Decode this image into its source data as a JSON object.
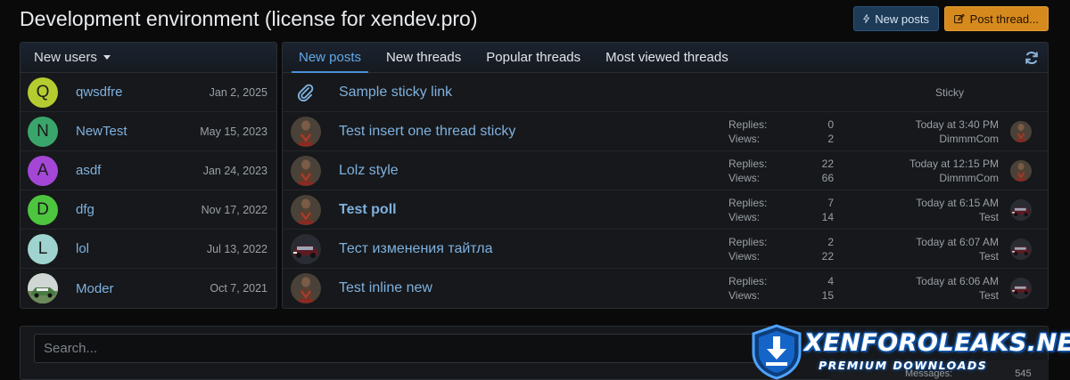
{
  "page": {
    "title": "Development environment (license for xendev.pro)"
  },
  "actions": {
    "new_posts": "New posts",
    "post_thread": "Post thread..."
  },
  "new_users": {
    "header": "New users",
    "items": [
      {
        "letter": "Q",
        "name": "qwsdfre",
        "date": "Jan 2, 2025",
        "color": "#b4cc2f"
      },
      {
        "letter": "N",
        "name": "NewTest",
        "date": "May 15, 2023",
        "color": "#3aa56b"
      },
      {
        "letter": "A",
        "name": "asdf",
        "date": "Jan 24, 2023",
        "color": "#a447d6"
      },
      {
        "letter": "D",
        "name": "dfg",
        "date": "Nov 17, 2022",
        "color": "#4ec53f"
      },
      {
        "letter": "L",
        "name": "lol",
        "date": "Jul 13, 2022",
        "color": "#9fd3cf"
      },
      {
        "letter": "",
        "name": "Moder",
        "date": "Oct 7, 2021",
        "color": "#6d8a6a"
      }
    ]
  },
  "tabs": [
    "New posts",
    "New threads",
    "Popular threads",
    "Most viewed threads"
  ],
  "threads": {
    "sticky_link": {
      "title": "Sample sticky link",
      "badge": "Sticky"
    },
    "replies_label": "Replies:",
    "views_label": "Views:",
    "items": [
      {
        "title": "Test insert one thread sticky",
        "replies": "0",
        "views": "2",
        "time": "Today at 3:40 PM",
        "user": "DimmmCom",
        "bold": false,
        "avatar": "statue"
      },
      {
        "title": "Lolz style",
        "replies": "22",
        "views": "66",
        "time": "Today at 12:15 PM",
        "user": "DimmmCom",
        "bold": false,
        "avatar": "statue"
      },
      {
        "title": "Test poll",
        "replies": "7",
        "views": "14",
        "time": "Today at 6:15 AM",
        "user": "Test",
        "bold": true,
        "avatar": "statue"
      },
      {
        "title": "Тест изменения тайтла",
        "replies": "2",
        "views": "22",
        "time": "Today at 6:07 AM",
        "user": "Test",
        "bold": false,
        "avatar": "car"
      },
      {
        "title": "Test inline new",
        "replies": "4",
        "views": "15",
        "time": "Today at 6:06 AM",
        "user": "Test",
        "bold": false,
        "avatar": "statue"
      }
    ]
  },
  "search": {
    "placeholder": "Search..."
  },
  "stats": {
    "label": "Messages:",
    "value": "545"
  },
  "watermark": {
    "top": "XENFOROLEAKS.NET",
    "bottom": "PREMIUM DOWNLOADS"
  }
}
